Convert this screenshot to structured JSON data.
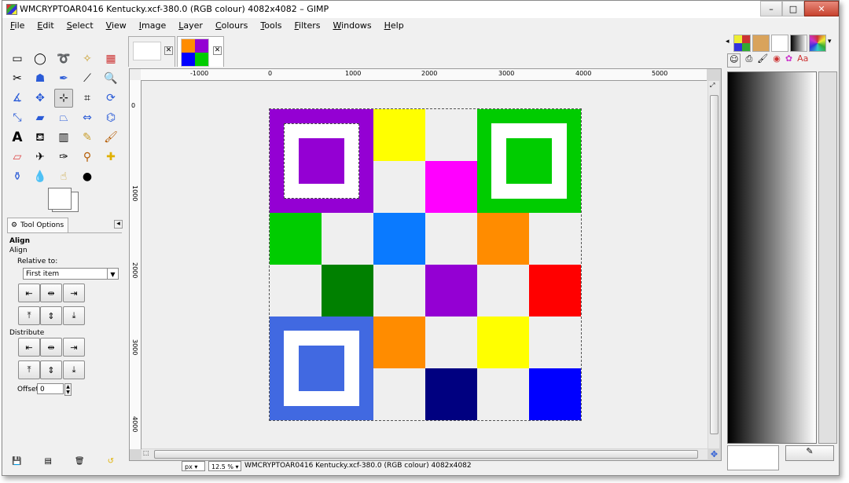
{
  "window": {
    "title": "WMCRYPTOAR0416 Kentucky.xcf-380.0 (RGB colour) 4082x4082 – GIMP",
    "controls": {
      "minimize": "–",
      "maximize": "□",
      "close": "✕"
    }
  },
  "menubar": [
    "File",
    "Edit",
    "Select",
    "View",
    "Image",
    "Layer",
    "Colours",
    "Tools",
    "Filters",
    "Windows",
    "Help"
  ],
  "tool_options": {
    "tab_label": "Tool Options",
    "heading": "Align",
    "subheading": "Align",
    "relative_to_label": "Relative to:",
    "relative_to_value": "First item",
    "distribute_label": "Distribute",
    "offset_label": "Offset:",
    "offset_value": "0"
  },
  "ruler": {
    "h_labels": [
      "-1000",
      "0",
      "1000",
      "2000",
      "3000",
      "4000",
      "5000"
    ],
    "v_labels": [
      "0",
      "1000",
      "2000",
      "3000",
      "4000"
    ]
  },
  "statusbar": {
    "unit": "px",
    "zoom": "12.5 %",
    "info": "WMCRYPTOAR0416 Kentucky.xcf-380.0 (RGB colour) 4082x4082"
  },
  "image_colors": {
    "purple": "#9400d3",
    "yellow": "#ffff00",
    "magenta": "#ff00ff",
    "green": "#00cc00",
    "dark_green": "#008000",
    "sky_blue": "#0a7aff",
    "orange": "#ff8c00",
    "red": "#ff0000",
    "royal_blue": "#4169e1",
    "navy": "#000080",
    "blue": "#0000ff"
  },
  "icons": {
    "tools": [
      "rect-select-icon",
      "ellipse-select-icon",
      "lasso-icon",
      "fuzzy-select-icon",
      "color-select-icon",
      "scissors-icon",
      "foreground-select-icon",
      "paths-icon",
      "color-picker-icon",
      "zoom-icon",
      "measure-icon",
      "move-icon",
      "align-icon",
      "crop-icon",
      "rotate-icon",
      "scale-icon",
      "shear-icon",
      "perspective-icon",
      "flip-icon",
      "cage-icon",
      "text-icon",
      "bucket-fill-icon",
      "blend-icon",
      "pencil-icon",
      "paintbrush-icon",
      "eraser-icon",
      "airbrush-icon",
      "ink-icon",
      "clone-icon",
      "heal-icon",
      "perspective-clone-icon",
      "blur-icon",
      "smudge-icon",
      "dodge-burn-icon"
    ]
  }
}
